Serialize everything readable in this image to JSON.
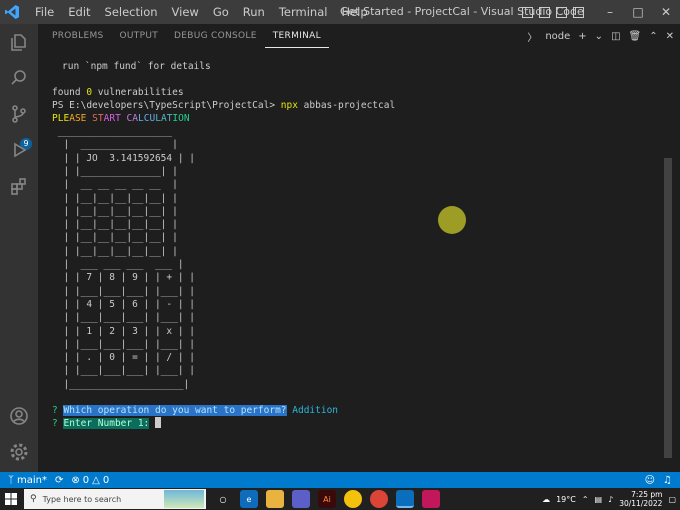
{
  "titlebar": {
    "menus": [
      "File",
      "Edit",
      "Selection",
      "View",
      "Go",
      "Run",
      "Terminal",
      "Help"
    ],
    "title": "Get Started - ProjectCal - Visual Studio Code"
  },
  "activity": {
    "scm_badge": "9"
  },
  "panel": {
    "tabs": [
      "PROBLEMS",
      "OUTPUT",
      "DEBUG CONSOLE",
      "TERMINAL"
    ],
    "shell": "node"
  },
  "terminal": {
    "line1": "run `npm fund` for details",
    "found_prefix": "found ",
    "found_zero": "0",
    "found_suffix": " vulnerabilities",
    "prompt": "PS E:\\developers\\TypeScript\\ProjectCal> ",
    "cmd_npx": "npx",
    "cmd_arg": " abbas-projectcal",
    "banner": "PLEASE START CALCULATION",
    "calc": [
      " ____________________",
      "  |  ______________  |",
      "  | | JO  3.141592654 | |",
      "  | |______________| |",
      "  |  __ __ __ __ __  |",
      "  | |__|__|__|__|__| |",
      "  | |__|__|__|__|__| |",
      "  | |__|__|__|__|__| |",
      "  | |__|__|__|__|__| |",
      "  | |__|__|__|__|__| |",
      "  |  ___ ___ ___  ___ |",
      "  | | 7 | 8 | 9 | | + | |",
      "  | |___|___|___| |___| |",
      "  | | 4 | 5 | 6 | | - | |",
      "  | |___|___|___| |___| |",
      "  | | 1 | 2 | 3 | | x | |",
      "  | |___|___|___| |___| |",
      "  | | . | 0 | = | | / | |",
      "  | |___|___|___| |___| |",
      "  |____________________|"
    ],
    "q1_mark": "?",
    "q1_text": "Which operation do you want to perform?",
    "q1_answer": " Addition",
    "q2_mark": "?",
    "q2_text": "Enter Number 1:"
  },
  "statusbar": {
    "branch": "main*",
    "errors": "0",
    "warnings": "0"
  },
  "taskbar": {
    "search_placeholder": "Type here to search",
    "temperature": "19°C",
    "time": "7:25 pm",
    "date": "30/11/2022"
  },
  "colors": {
    "accent": "#007acc",
    "titlebar": "#3c3c3c",
    "terminal_bg": "#1e1e1e",
    "yellow": "#e5e510",
    "selection": "#2a73c7"
  }
}
